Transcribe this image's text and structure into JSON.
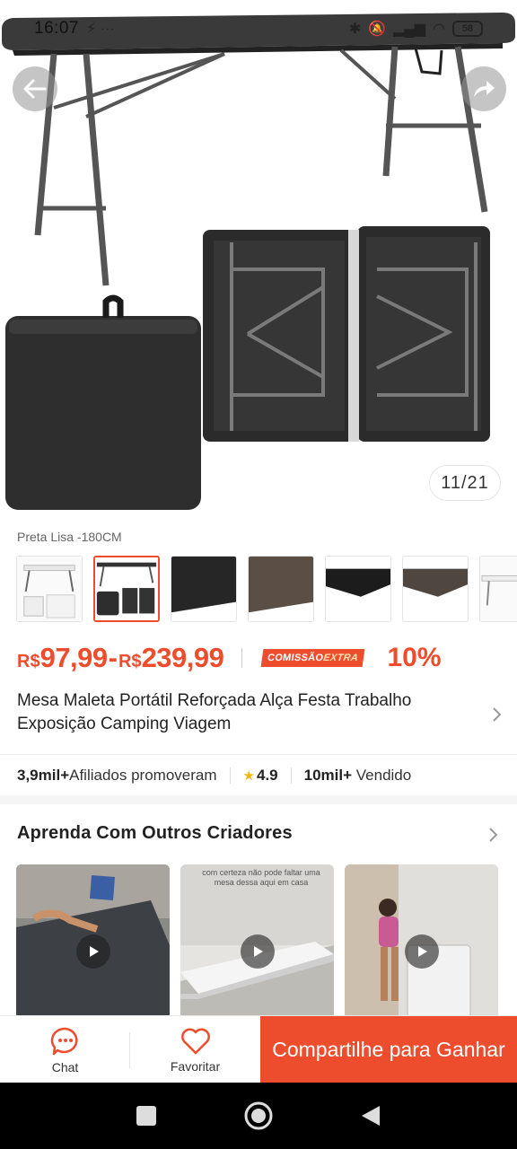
{
  "status_bar": {
    "time": "16:07",
    "left_icons": "⚡ ···",
    "battery": "58"
  },
  "gallery": {
    "counter": "11/21"
  },
  "variant": {
    "label": "Preta Lisa -180CM",
    "thumbnails": [
      {
        "name": "white-table",
        "selected": false
      },
      {
        "name": "black-table-open",
        "selected": true
      },
      {
        "name": "black-texture",
        "selected": false
      },
      {
        "name": "brown-texture",
        "selected": false
      },
      {
        "name": "black-surface",
        "selected": false
      },
      {
        "name": "brown-surface",
        "selected": false
      },
      {
        "name": "white-table-partial",
        "selected": false
      }
    ]
  },
  "price": {
    "currency": "R$",
    "min": "97,99",
    "separator": "-",
    "max": "239,99"
  },
  "commission": {
    "badge_main": "COMISSÃO",
    "badge_extra": "EXTRA",
    "percent": "10%"
  },
  "product": {
    "title": "Mesa Maleta Portátil Reforçada Alça Festa Trabalho Exposição Camping Viagem"
  },
  "stats": {
    "affiliates_count": "3,9mil+",
    "affiliates_label": "Afiliados promoveram",
    "rating": "4.9",
    "sold_count": "10mil+",
    "sold_label": "Vendido"
  },
  "learn": {
    "title": "Aprenda Com Outros Criadores",
    "videos": [
      {
        "caption": ""
      },
      {
        "caption": "com certeza não pode faltar uma mesa dessa aqui em casa"
      },
      {
        "caption": ""
      }
    ]
  },
  "bottom_bar": {
    "chat_label": "Chat",
    "favorite_label": "Favoritar",
    "share_label": "Compartilhe para Ganhar"
  },
  "colors": {
    "accent": "#ee4d2d",
    "star": "#f7b500"
  }
}
